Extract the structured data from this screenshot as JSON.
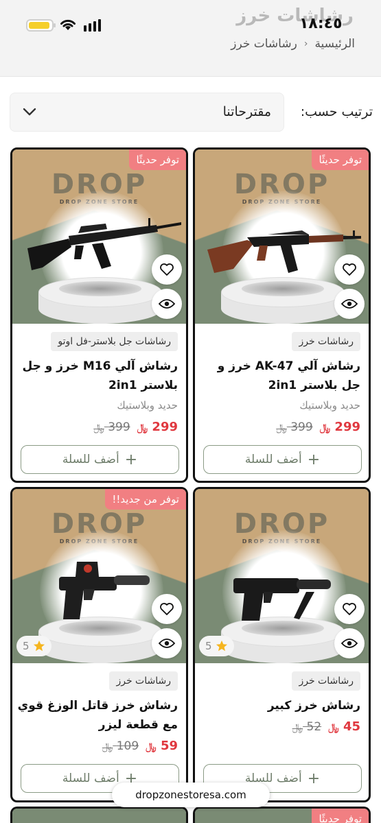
{
  "status": {
    "time": "١٨:٤٥",
    "battery_color": "#f5cf2b"
  },
  "header": {
    "title": "رشاشات خرز",
    "breadcrumb": [
      "الرئيسية",
      "رشاشات خرز"
    ]
  },
  "sort": {
    "label": "ترتيب حسب:",
    "value": "مقترحاتنا"
  },
  "currency": "﷼",
  "colors": {
    "badge": "#f17f82",
    "price": "#e0383f",
    "button_border": "#8a9a85"
  },
  "products": [
    {
      "badge": "توفر حديثًا",
      "category": "رشاشات خرز",
      "name": "رشاش آلي AK-47 خرز و جل بلاستر 2in1",
      "material": "حديد وبلاستيك",
      "price": "299",
      "old_price": "399",
      "add_label": "أضف للسلة",
      "icon": "rifle-ak47"
    },
    {
      "badge": "توفر حديثًا",
      "category": "رشاشات جل بلاستر-فل اوتو",
      "name": "رشاش آلي M16 خرز و جل بلاستر 2in1",
      "material": "حديد وبلاستيك",
      "price": "299",
      "old_price": "399",
      "add_label": "أضف للسلة",
      "icon": "rifle-m16"
    },
    {
      "rating": "5",
      "category": "رشاشات خرز",
      "name": "رشاش خرز كبير",
      "price": "45",
      "old_price": "52",
      "add_label": "أضف للسلة",
      "icon": "pistol-silencer"
    },
    {
      "badge": "توفر من جديد!!",
      "rating": "5",
      "category": "رشاشات خرز",
      "name": "رشاش خرز قاتل الوزغ قوي مع قطعة ليزر",
      "price": "59",
      "old_price": "109",
      "add_label": "أضف للسلة",
      "icon": "pistol-laser"
    },
    {
      "badge": "توفر حديثًا"
    }
  ],
  "product_image_logo": "DROP",
  "product_image_logo_sub": "DROP ZONE STORE",
  "url": "dropzonestoresa.com"
}
